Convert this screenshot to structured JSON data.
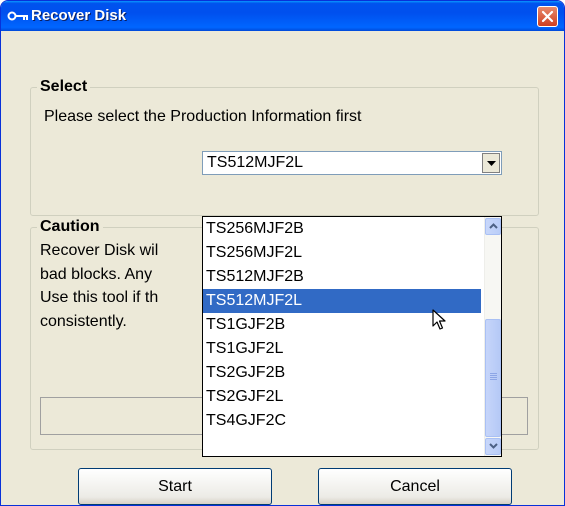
{
  "window": {
    "title": "Recover Disk"
  },
  "select_group": {
    "legend": "Select",
    "instruction": "Please select the Production Information first",
    "selected_value": "TS512MJF2L"
  },
  "caution_group": {
    "legend": "Caution",
    "lines": [
      "Recover Disk wil",
      "bad blocks. Any",
      "Use this tool if th",
      "consistently."
    ]
  },
  "dropdown": {
    "items": [
      "TS256MJF2B",
      "TS256MJF2L",
      "TS512MJF2B",
      "TS512MJF2L",
      "TS1GJF2B",
      "TS1GJF2L",
      "TS2GJF2B",
      "TS2GJF2L",
      "TS4GJF2C"
    ],
    "highlighted": "TS512MJF2L"
  },
  "buttons": {
    "start": "Start",
    "cancel": "Cancel"
  },
  "colors": {
    "titlebar": "#0054e3",
    "selection": "#316ac5",
    "face": "#ece9d8"
  }
}
